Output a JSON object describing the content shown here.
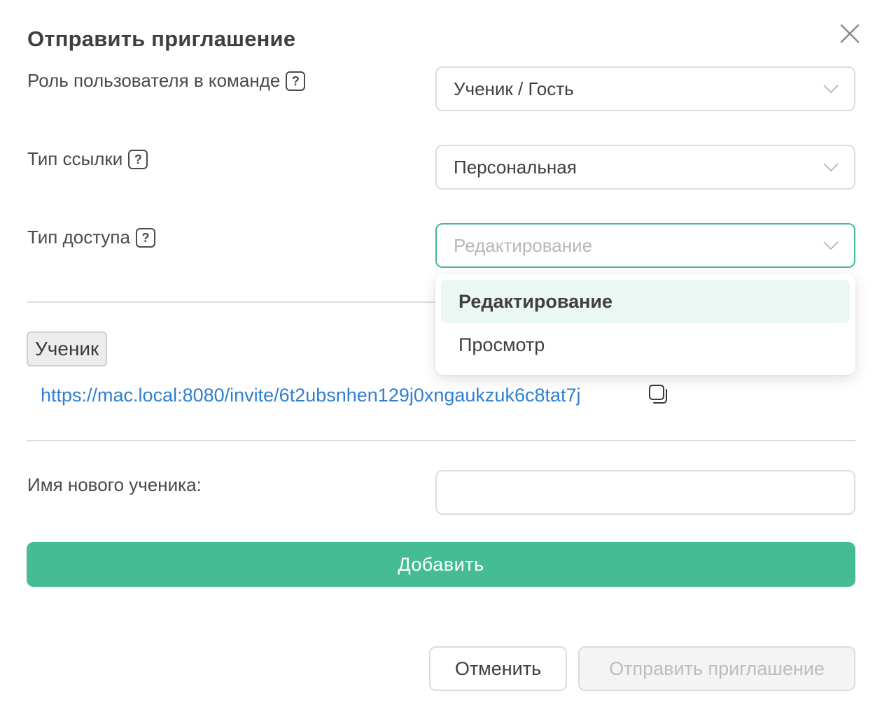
{
  "dialog": {
    "title": "Отправить приглашение",
    "close_icon": "close-icon"
  },
  "form": {
    "role": {
      "label": "Роль пользователя в команде",
      "help": "?",
      "value": "Ученик / Гость"
    },
    "link_type": {
      "label": "Тип ссылки",
      "help": "?",
      "value": "Персональная"
    },
    "access_type": {
      "label": "Тип доступа",
      "help": "?",
      "placeholder": "Редактирование"
    }
  },
  "dropdown": {
    "options": [
      {
        "label": "Редактирование",
        "active": true
      },
      {
        "label": "Просмотр",
        "active": false
      }
    ]
  },
  "invite": {
    "tag": "Ученик",
    "link": "https://mac.local:8080/invite/6t2ubsnhen129j0xngaukzuk6c8tat7j",
    "copy_icon": "copy-icon"
  },
  "new_student": {
    "label": "Имя нового ученика:",
    "value": "",
    "add_button": "Добавить"
  },
  "footer": {
    "cancel": "Отменить",
    "send": "Отправить приглашение"
  },
  "colors": {
    "accent": "#45bc93",
    "focus_border": "#45b891",
    "link": "#2f7fd1",
    "option_active_bg": "#ebf7f2"
  }
}
